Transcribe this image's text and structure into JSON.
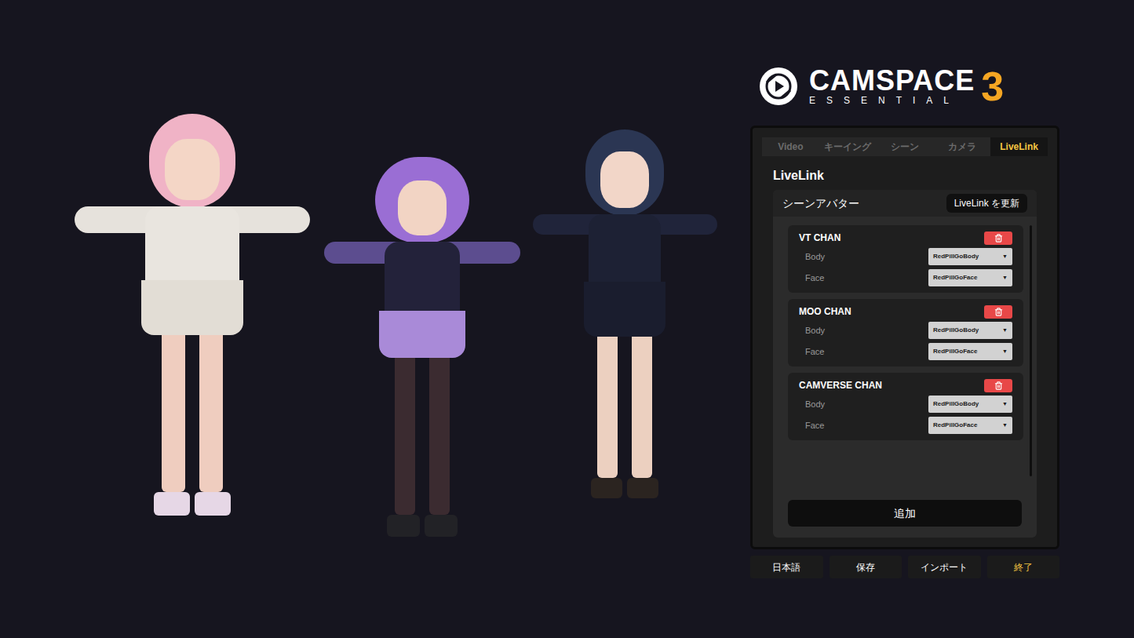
{
  "logo": {
    "name": "CAMSPACE",
    "sub": "ESSENTIAL",
    "version": "3"
  },
  "tabs": [
    {
      "label": "Video",
      "selected": false
    },
    {
      "label": "キーイング",
      "selected": false
    },
    {
      "label": "シーン",
      "selected": false
    },
    {
      "label": "カメラ",
      "selected": false
    },
    {
      "label": "LiveLink",
      "selected": true
    }
  ],
  "panel": {
    "title": "LiveLink",
    "section": {
      "title": "シーンアバター",
      "refresh_button": "LiveLink を更新"
    }
  },
  "avatars": [
    {
      "name": "VT CHAN",
      "fields": [
        {
          "label": "Body",
          "value": "RedPillGoBody",
          "arrow": "▼"
        },
        {
          "label": "Face",
          "value": "RedPillGoFace",
          "arrow": "▼"
        }
      ]
    },
    {
      "name": "MOO CHAN",
      "fields": [
        {
          "label": "Body",
          "value": "RedPillGoBody",
          "arrow": "▼"
        },
        {
          "label": "Face",
          "value": "RedPillGoFace",
          "arrow": "▼"
        }
      ]
    },
    {
      "name": "CAMVERSE CHAN",
      "fields": [
        {
          "label": "Body",
          "value": "RedPillGoBody",
          "arrow": "▼"
        },
        {
          "label": "Face",
          "value": "RedPillGoFace",
          "arrow": "▼"
        }
      ]
    }
  ],
  "list_scrollbar": {
    "level": 1
  },
  "add_button": "追加",
  "footer_buttons": [
    {
      "label": "日本語",
      "highlight": false
    },
    {
      "label": "保存",
      "highlight": false
    },
    {
      "label": "インポート",
      "highlight": false
    },
    {
      "label": "終了",
      "highlight": true
    }
  ]
}
